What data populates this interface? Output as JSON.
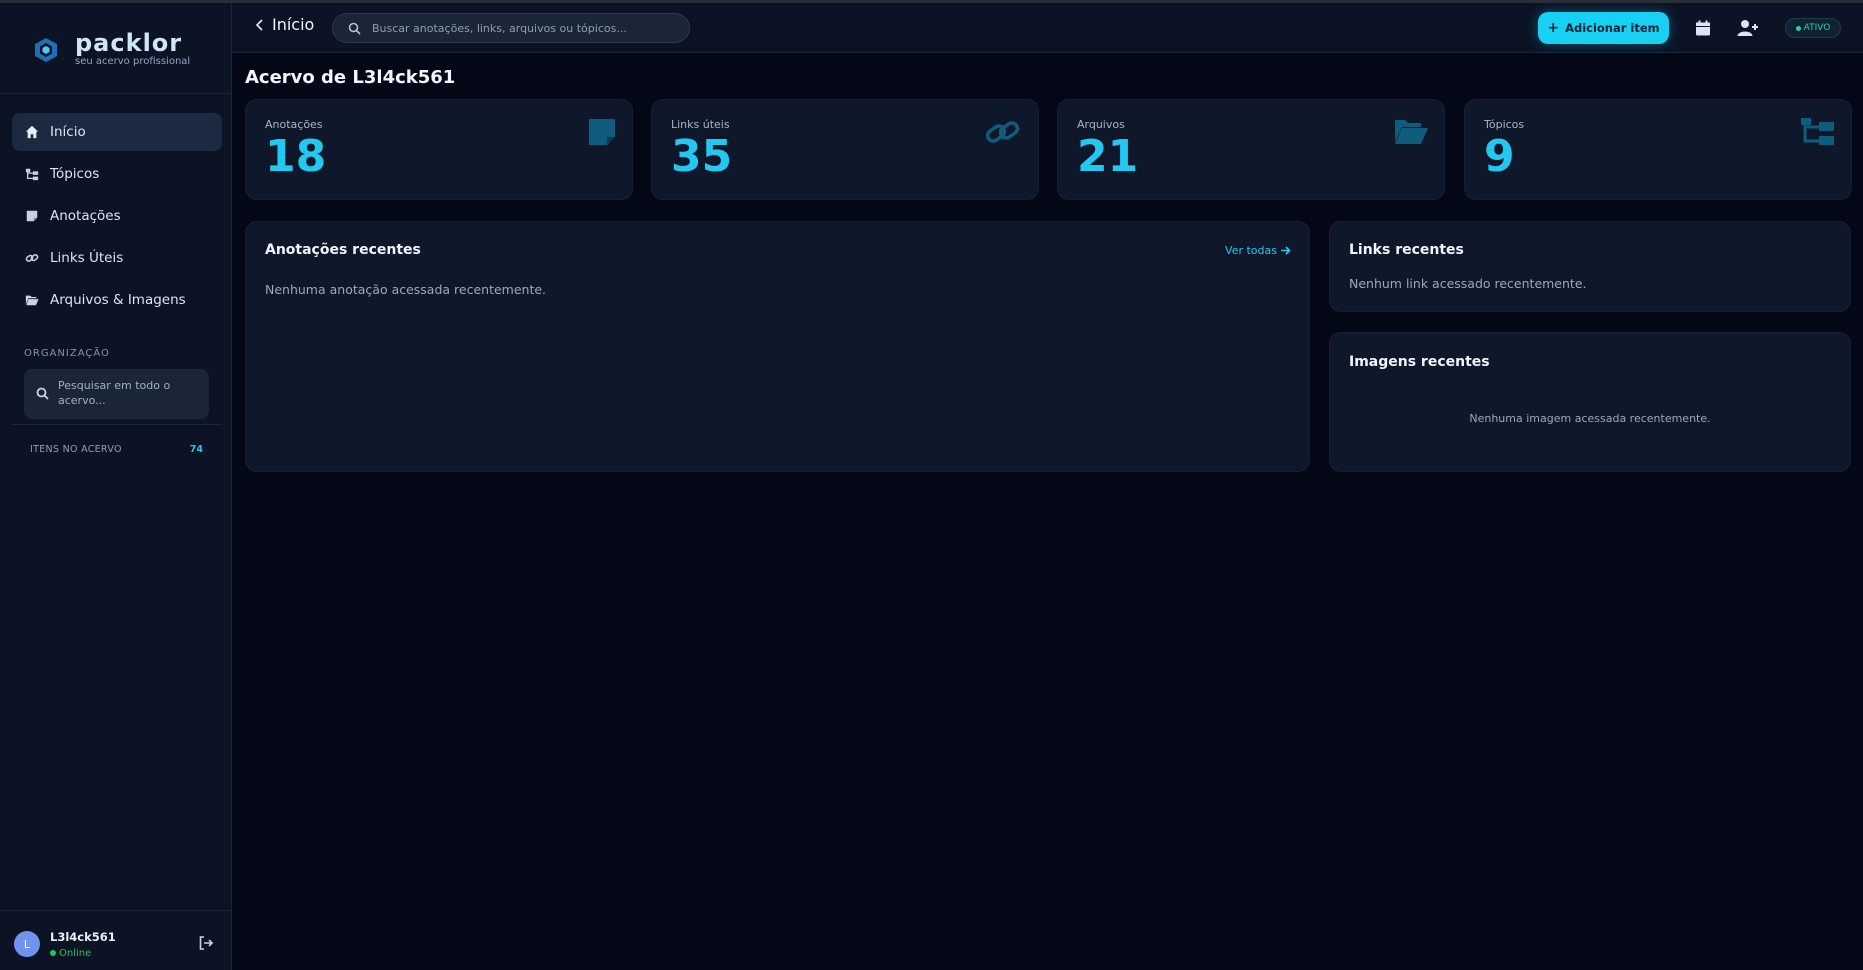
{
  "brand": {
    "name": "packlor",
    "tagline": "seu acervo profissional"
  },
  "sidebar": {
    "items": [
      {
        "label": "Início",
        "icon": "home-icon",
        "active": true
      },
      {
        "label": "Tópicos",
        "icon": "topics-tree-icon"
      },
      {
        "label": "Anotações",
        "icon": "note-icon"
      },
      {
        "label": "Links Úteis",
        "icon": "link-icon"
      },
      {
        "label": "Arquivos & Imagens",
        "icon": "folder-open-icon"
      }
    ],
    "section_label": "ORGANIZAÇÃO",
    "search_placeholder": "Pesquisar em todo o acervo...",
    "count_label": "ITENS NO ACERVO",
    "count_value": "74"
  },
  "user": {
    "initial": "L",
    "name": "L3l4ck561",
    "status": "Online"
  },
  "header": {
    "back_label": "Início",
    "search_placeholder": "Buscar anotações, links, arquivos ou tópicos...",
    "add_button": "Adicionar item",
    "status_badge": "ATIVO"
  },
  "main": {
    "title": "Acervo de L3l4ck561",
    "stats": [
      {
        "label": "Anotações",
        "value": "18",
        "icon": "note-icon"
      },
      {
        "label": "Links úteis",
        "value": "35",
        "icon": "link-icon"
      },
      {
        "label": "Arquivos",
        "value": "21",
        "icon": "folder-open-icon"
      },
      {
        "label": "Tópicos",
        "value": "9",
        "icon": "topics-tree-icon"
      }
    ],
    "recent_notes": {
      "title": "Anotações recentes",
      "see_all": "Ver todas",
      "empty": "Nenhuma anotação acessada recentemente."
    },
    "recent_links": {
      "title": "Links recentes",
      "empty": "Nenhum link acessado recentemente."
    },
    "recent_images": {
      "title": "Imagens recentes",
      "empty": "Nenhuma imagem acessada recentemente."
    }
  },
  "colors": {
    "accent": "#22c8ef",
    "background": "#040816",
    "panel": "#0f182b",
    "online": "#22c55e"
  }
}
